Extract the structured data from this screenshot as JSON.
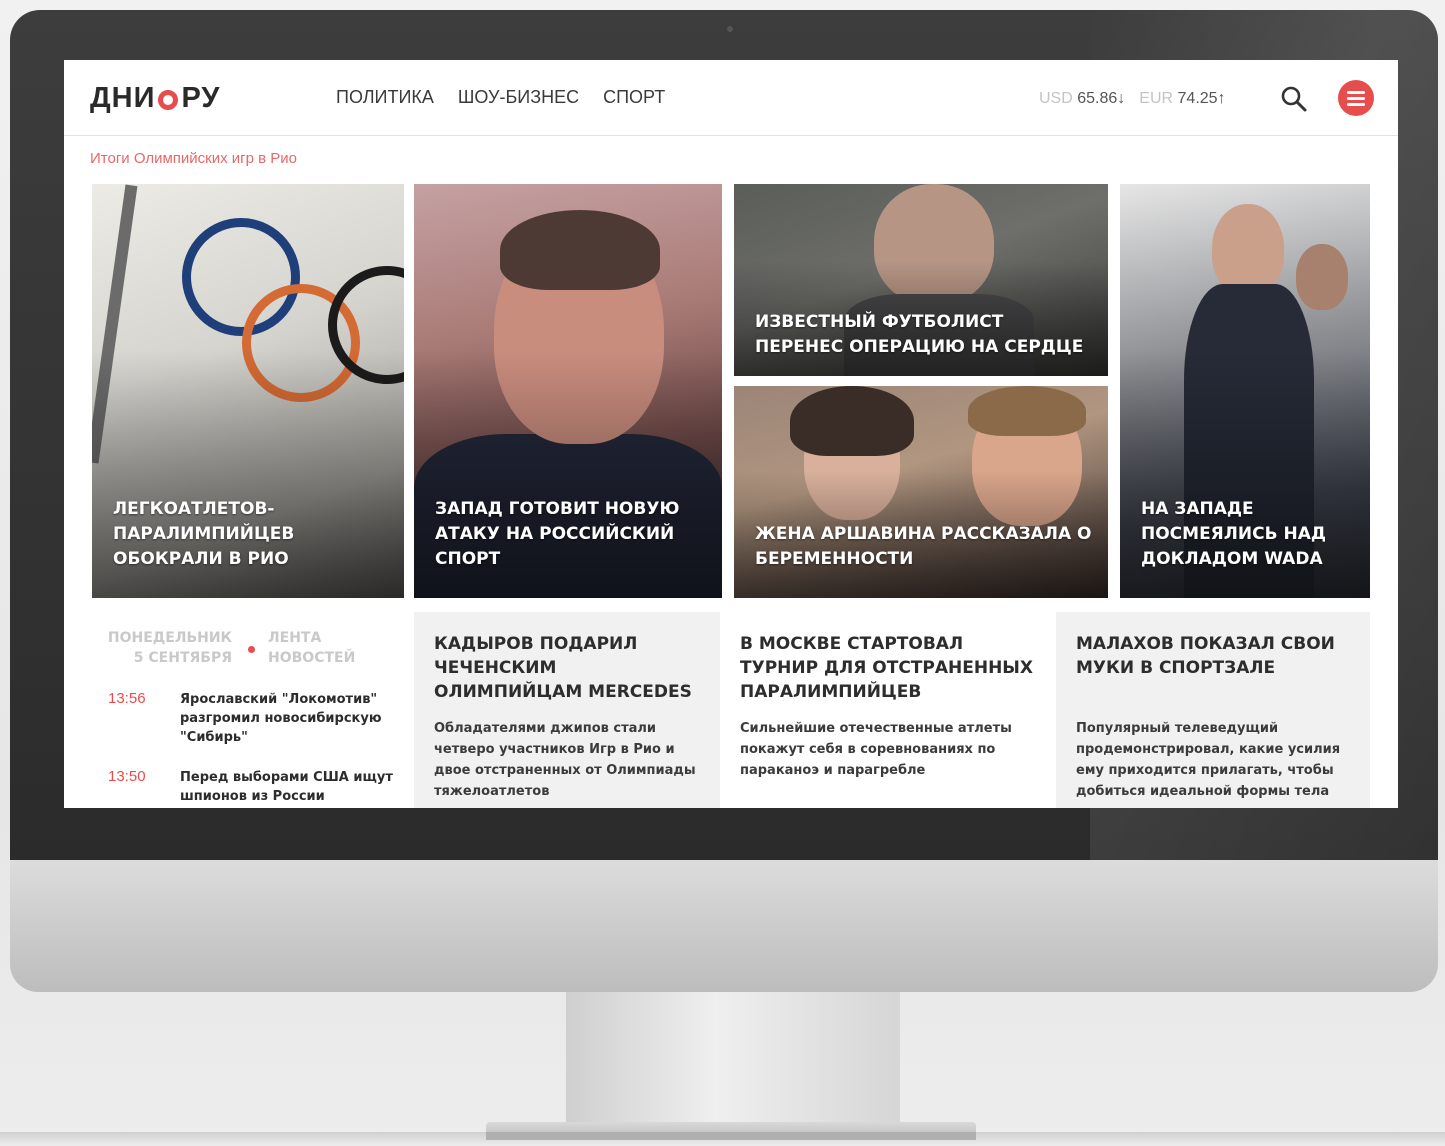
{
  "site": {
    "logo": "ДНИОРУ",
    "nav": [
      "ПОЛИТИКА",
      "ШОУ-БИЗНЕС",
      "СПОРТ"
    ],
    "rates": {
      "usd_code": "USD",
      "usd_value": "65.86↓",
      "eur_code": "EUR",
      "eur_value": "74.25↑"
    },
    "breadcrumb": "Итоги Олимпийских игр в Рио"
  },
  "tiles": [
    {
      "title": "Легкоатлетов-паралимпийцев обокрали в Рио",
      "icon": "olympic-flag-photo"
    },
    {
      "title": "Запад готовит новую атаку на российский спорт",
      "icon": "official-portrait-photo"
    },
    {
      "title": "Известный футболист перенес операцию на сердце",
      "icon": "footballer-photo"
    },
    {
      "title": "Жена Аршавина рассказала о беременности",
      "icon": "couple-photo"
    },
    {
      "title": "На Западе посмеялись над докладом WADA",
      "icon": "press-walk-photo"
    }
  ],
  "feed": {
    "date": "Понедельник 5 сентября",
    "label": "Лента новостей",
    "items": [
      {
        "time": "13:56",
        "text": "Ярославский \"Локомотив\" разгромил новосибирскую \"Сибирь\""
      },
      {
        "time": "13:50",
        "text": "Перед выборами США ищут шпионов из России"
      }
    ]
  },
  "cards": [
    {
      "title": "Кадыров подарил чеченским олимпийцам Mercedes",
      "text": "Обладателями джипов стали четверо участников Игр в Рио и двое отстраненных от Олимпиады тяжелоатлетов"
    },
    {
      "title": "В Москве стартовал турнир для отстраненных паралимпийцев",
      "text": "Сильнейшие отечественные атлеты покажут себя в соревнованиях по параканоэ и парагребле"
    },
    {
      "title": "Малахов показал свои муки в спортзале",
      "text": "Популярный телеведущий продемонстрировал, какие усилия ему приходится прилагать, чтобы добиться идеальной формы тела"
    }
  ],
  "colors": {
    "accent": "#e84d4d",
    "bezel": "#2f2f2f",
    "card_bg": "#f1f1f1"
  }
}
